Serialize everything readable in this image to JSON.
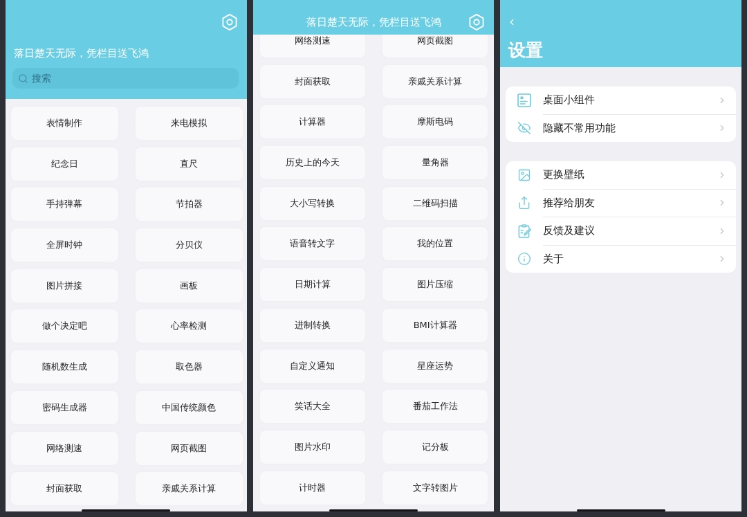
{
  "screens": [
    {
      "kind": "home",
      "header": {
        "quote": "落日楚天无际，凭栏目送飞鸿"
      },
      "search": {
        "placeholder": "搜索"
      },
      "tools": [
        "表情制作",
        "来电模拟",
        "纪念日",
        "直尺",
        "手持弹幕",
        "节拍器",
        "全屏时钟",
        "分贝仪",
        "图片拼接",
        "画板",
        "做个决定吧",
        "心率检测",
        "随机数生成",
        "取色器",
        "密码生成器",
        "中国传统颜色",
        "网络测速",
        "网页截图",
        "封面获取",
        "亲戚关系计算"
      ]
    },
    {
      "kind": "scrolled",
      "header": {
        "quote": "落日楚天无际，凭栏目送飞鸿"
      },
      "tools": [
        "网络测速",
        "网页截图",
        "封面获取",
        "亲戚关系计算",
        "计算器",
        "摩斯电码",
        "历史上的今天",
        "量角器",
        "大小写转换",
        "二维码扫描",
        "语音转文字",
        "我的位置",
        "日期计算",
        "图片压缩",
        "进制转换",
        "BMI计算器",
        "自定义通知",
        "星座运势",
        "笑话大全",
        "番茄工作法",
        "图片水印",
        "记分板",
        "计时器",
        "文字转图片"
      ]
    },
    {
      "kind": "settings",
      "header": {
        "title": "设置"
      },
      "groups": [
        {
          "items": [
            "桌面小组件",
            "隐藏不常用功能"
          ]
        },
        {
          "items": [
            "更换壁纸",
            "推荐给朋友",
            "反馈及建议",
            "关于"
          ]
        }
      ]
    }
  ]
}
